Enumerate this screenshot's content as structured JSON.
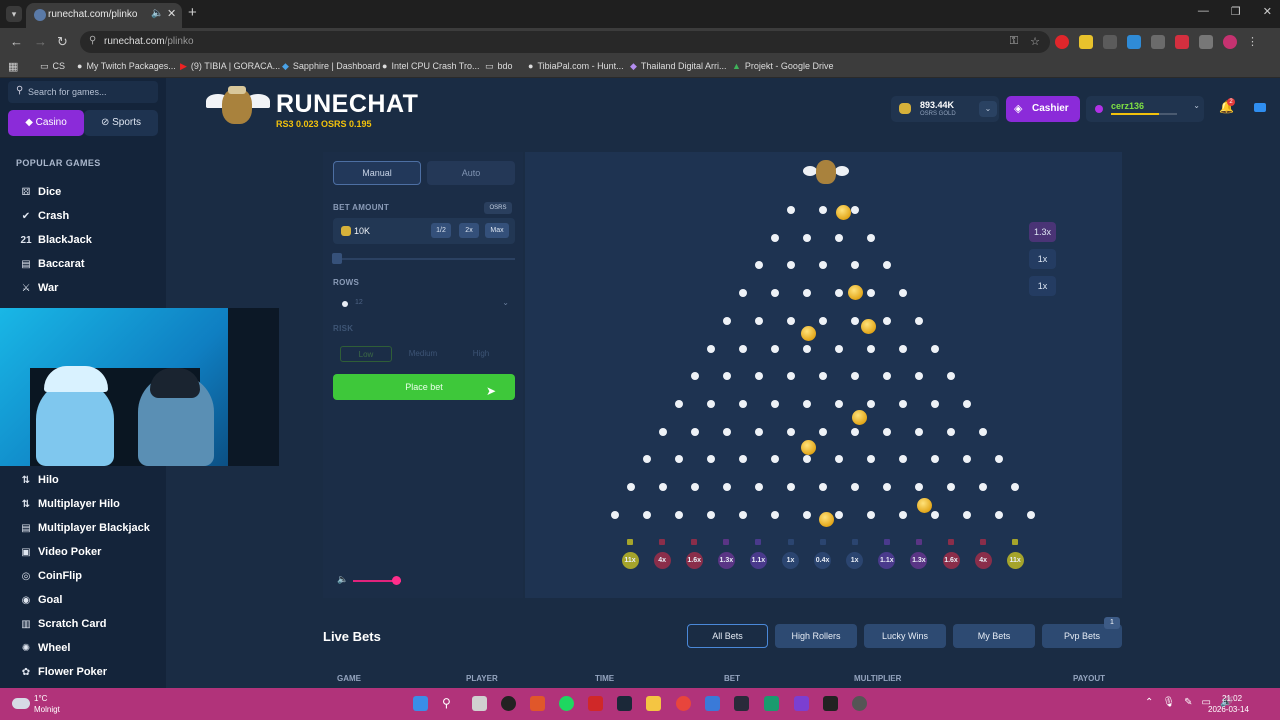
{
  "browser": {
    "tab_title": "runechat.com/plinko",
    "url_host": "runechat.com",
    "url_path": "/plinko",
    "bookmarks": [
      {
        "label": "CS",
        "icon": "folder-icon"
      },
      {
        "label": "My Twitch Packages...",
        "icon": "globe-icon"
      },
      {
        "label": "(9) TIBIA | GORACA...",
        "icon": "youtube-icon"
      },
      {
        "label": "Sapphire | Dashboard",
        "icon": "shield-icon"
      },
      {
        "label": "Intel CPU Crash Tro...",
        "icon": "globe-icon"
      },
      {
        "label": "bdo",
        "icon": "folder-icon"
      },
      {
        "label": "TibiaPal.com - Hunt...",
        "icon": "globe-icon"
      },
      {
        "label": "Thailand Digital Arri...",
        "icon": "shield-icon"
      },
      {
        "label": "Projekt - Google Drive",
        "icon": "drive-icon"
      }
    ]
  },
  "sidebar": {
    "search_placeholder": "Search for games...",
    "casino_label": "Casino",
    "sports_label": "Sports",
    "popular_heading": "POPULAR GAMES",
    "items_top": [
      {
        "label": "Dice",
        "icon": "dice-icon"
      },
      {
        "label": "Crash",
        "icon": "check-icon"
      },
      {
        "label": "BlackJack",
        "icon": "cards-icon"
      },
      {
        "label": "Baccarat",
        "icon": "cards-icon"
      },
      {
        "label": "War",
        "icon": "swords-icon"
      }
    ],
    "items_bottom": [
      {
        "label": "Hilo",
        "icon": "hilo-icon"
      },
      {
        "label": "Multiplayer Hilo",
        "icon": "hilo-icon"
      },
      {
        "label": "Multiplayer Blackjack",
        "icon": "cards-icon"
      },
      {
        "label": "Video Poker",
        "icon": "poker-icon"
      },
      {
        "label": "CoinFlip",
        "icon": "coin-icon"
      },
      {
        "label": "Goal",
        "icon": "ball-icon"
      },
      {
        "label": "Scratch Card",
        "icon": "card-icon"
      },
      {
        "label": "Wheel",
        "icon": "wheel-icon"
      },
      {
        "label": "Flower Poker",
        "icon": "flower-icon"
      }
    ]
  },
  "header": {
    "brand": "RUNECHAT",
    "rates": "RS3 0.023   OSRS 0.195",
    "balance_amount": "893.44K",
    "balance_currency": "OSRS GOLD",
    "cashier_label": "Cashier",
    "username": "cerz136",
    "notifications": "2"
  },
  "game": {
    "mode_manual": "Manual",
    "mode_auto": "Auto",
    "bet_label": "BET AMOUNT",
    "currency_badge": "OSRS",
    "bet_value": "10K",
    "half_label": "1/2",
    "double_label": "2x",
    "max_label": "Max",
    "rows_label": "ROWS",
    "rows_value": "12",
    "risk_label": "RISK",
    "risk_low": "Low",
    "risk_medium": "Medium",
    "risk_high": "High",
    "place_bet": "Place bet",
    "volume": 0.9,
    "rows": 12,
    "buckets": [
      {
        "label": "11x",
        "color": "#a5a42b"
      },
      {
        "label": "4x",
        "color": "#8a2e4a"
      },
      {
        "label": "1.6x",
        "color": "#8a2e4a"
      },
      {
        "label": "1.3x",
        "color": "#5a3585"
      },
      {
        "label": "1.1x",
        "color": "#4a3a8c"
      },
      {
        "label": "1x",
        "color": "#2b4570"
      },
      {
        "label": "0.4x",
        "color": "#2b4570"
      },
      {
        "label": "1x",
        "color": "#2b4570"
      },
      {
        "label": "1.1x",
        "color": "#4a3a8c"
      },
      {
        "label": "1.3x",
        "color": "#5a3585"
      },
      {
        "label": "1.6x",
        "color": "#8a2e4a"
      },
      {
        "label": "4x",
        "color": "#8a2e4a"
      },
      {
        "label": "11x",
        "color": "#a5a42b"
      }
    ],
    "history": [
      {
        "label": "1.3x",
        "color": "#4a3476"
      },
      {
        "label": "1x",
        "color": "#243c62"
      },
      {
        "label": "1x",
        "color": "#243c62"
      }
    ]
  },
  "live_bets": {
    "title": "Live Bets",
    "tabs": [
      "All Bets",
      "High Rollers",
      "Lucky Wins",
      "My Bets",
      "Pvp Bets"
    ],
    "pvp_badge": "1",
    "columns": [
      "GAME",
      "PLAYER",
      "TIME",
      "BET",
      "MULTIPLIER",
      "PAYOUT"
    ]
  },
  "taskbar": {
    "temp": "1°C",
    "weather": "Molnigt",
    "time": "21:02",
    "date": "2026-03-14"
  }
}
